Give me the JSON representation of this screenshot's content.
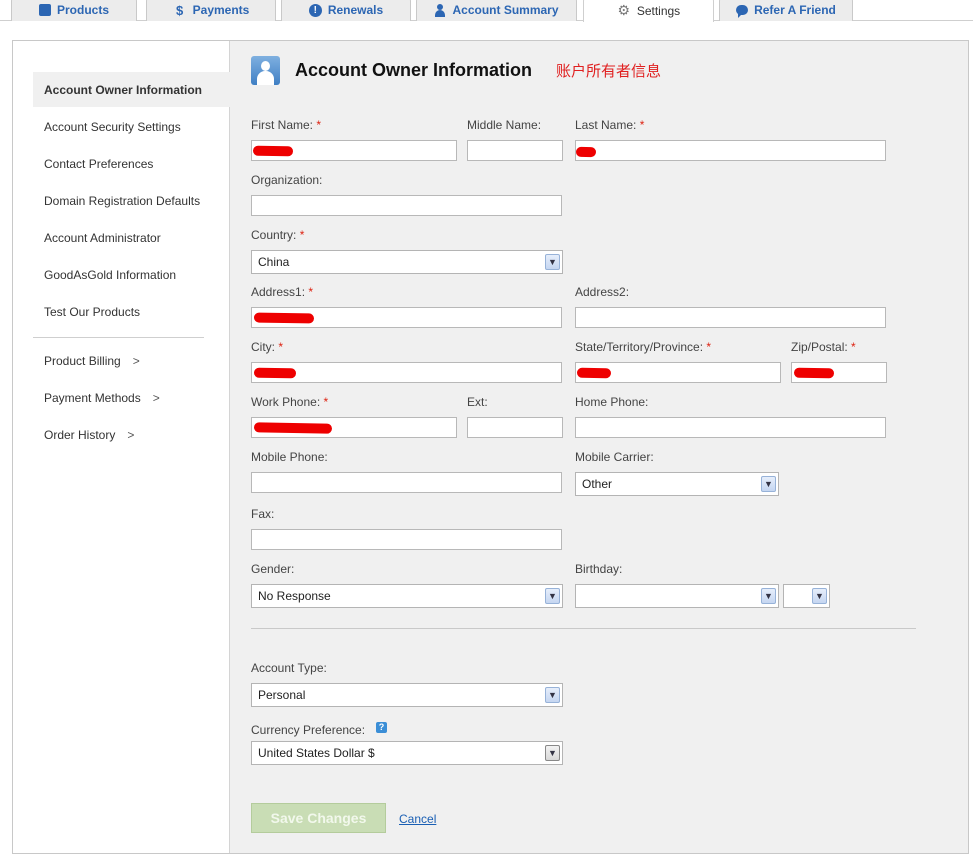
{
  "tabs": [
    {
      "label": "Products",
      "icon": "box-icon"
    },
    {
      "label": "Payments",
      "icon": "dollar-icon"
    },
    {
      "label": "Renewals",
      "icon": "alert-icon"
    },
    {
      "label": "Account Summary",
      "icon": "person-icon"
    },
    {
      "label": "Settings",
      "icon": "gear-icon",
      "active": true
    },
    {
      "label": "Refer A Friend",
      "icon": "speech-bubble-icon"
    }
  ],
  "sidebar": {
    "items": [
      {
        "label": "Account Owner Information",
        "active": true
      },
      {
        "label": "Account Security Settings"
      },
      {
        "label": "Contact Preferences"
      },
      {
        "label": "Domain Registration Defaults"
      },
      {
        "label": "Account Administrator"
      },
      {
        "label": "GoodAsGold Information"
      },
      {
        "label": "Test Our Products"
      }
    ],
    "sub_items": [
      {
        "label": "Product Billing",
        "arrow": ">"
      },
      {
        "label": "Payment Methods",
        "arrow": ">"
      },
      {
        "label": "Order History",
        "arrow": ">"
      }
    ]
  },
  "header": {
    "title": "Account Owner Information",
    "annotation_cn": "账户所有者信息"
  },
  "form": {
    "required_mark": "*",
    "first_name": {
      "label": "First Name:",
      "value": ""
    },
    "middle_name": {
      "label": "Middle Name:",
      "value": ""
    },
    "last_name": {
      "label": "Last Name:",
      "value": ""
    },
    "organization": {
      "label": "Organization:",
      "value": ""
    },
    "country": {
      "label": "Country:",
      "value": "China"
    },
    "address1": {
      "label": "Address1:",
      "value": ""
    },
    "address2": {
      "label": "Address2:",
      "value": ""
    },
    "city": {
      "label": "City:",
      "value": ""
    },
    "state": {
      "label": "State/Territory/Province:",
      "value": ""
    },
    "zip": {
      "label": "Zip/Postal:",
      "value": ""
    },
    "work_phone": {
      "label": "Work Phone:",
      "value": ""
    },
    "ext": {
      "label": "Ext:",
      "value": ""
    },
    "home_phone": {
      "label": "Home Phone:",
      "value": ""
    },
    "mobile_phone": {
      "label": "Mobile Phone:",
      "value": ""
    },
    "mobile_carrier": {
      "label": "Mobile Carrier:",
      "value": "Other"
    },
    "fax": {
      "label": "Fax:",
      "value": ""
    },
    "gender": {
      "label": "Gender:",
      "value": "No Response"
    },
    "birthday": {
      "label": "Birthday:",
      "month": "",
      "day": ""
    },
    "account_type": {
      "label": "Account Type:",
      "value": "Personal"
    },
    "currency": {
      "label": "Currency Preference:",
      "value": "United States Dollar $",
      "help": "?"
    }
  },
  "actions": {
    "save_label": "Save Changes",
    "cancel_label": "Cancel"
  },
  "colors": {
    "tab_text": "#2c66b3",
    "required": "#dd1111",
    "annotation": "#e02020",
    "save_button_bg": "#c9ddb5",
    "link": "#1a5fb4",
    "redaction": "#ee0000"
  }
}
